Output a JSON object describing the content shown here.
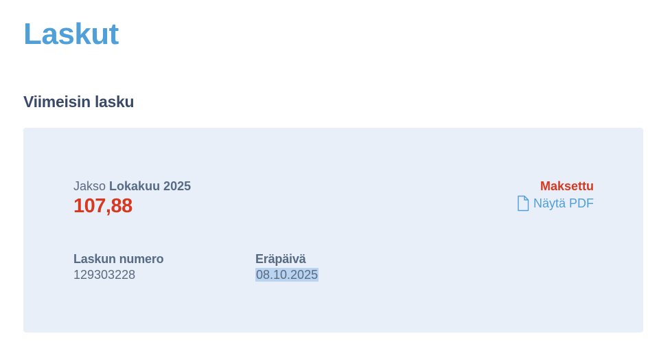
{
  "header": {
    "title": "Laskut"
  },
  "latest_invoice": {
    "section_title": "Viimeisin lasku",
    "period_label": "Jakso",
    "period_value": "Lokakuu 2025",
    "amount": "107,88",
    "status": "Maksettu",
    "pdf_link_label": "Näytä PDF",
    "pdf_icon": "document-icon",
    "invoice_number_label": "Laskun numero",
    "invoice_number_value": "129303228",
    "due_date_label": "Eräpäivä",
    "due_date_value": "08.10.2025"
  },
  "colors": {
    "title": "#4f9fd9",
    "section_title": "#3a4a66",
    "card_background": "#e8eff8",
    "amount": "#d8381f",
    "status_paid": "#d8381f",
    "link": "#4f9fd9",
    "text_selection": "#b9d4f0"
  }
}
